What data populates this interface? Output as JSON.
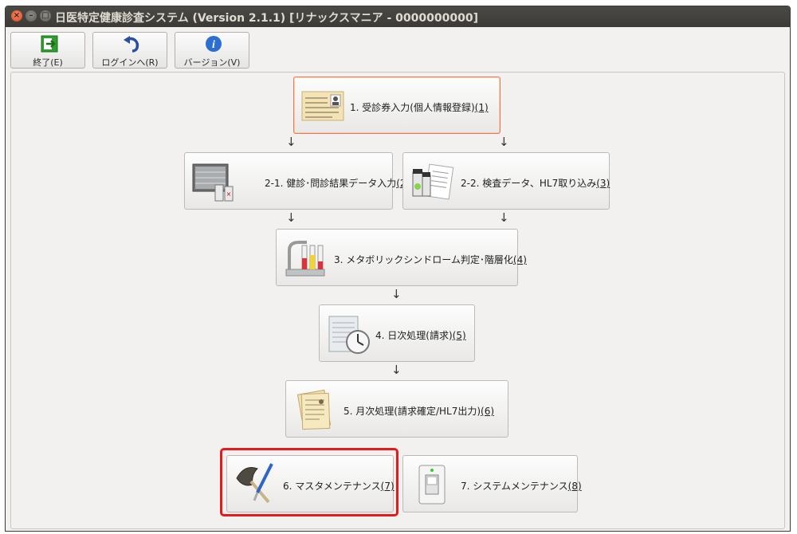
{
  "window": {
    "title": "日医特定健康診査システム (Version 2.1.1) [リナックスマニア - 0000000000]"
  },
  "toolbar": {
    "exit_label": "終了(E)",
    "login_label": "ログインへ(R)",
    "version_label": "バージョン(V)"
  },
  "menu": {
    "b1": {
      "text": "1. 受診券入力(個人情報登録)",
      "key": "(1)"
    },
    "b21": {
      "text": "2-1. 健診･問診結果データ入力",
      "key": "(2)"
    },
    "b22": {
      "text": "2-2. 検査データ、HL7取り込み",
      "key": "(3)"
    },
    "b3": {
      "text": "3. メタボリックシンドローム判定･階層化",
      "key": "(4)"
    },
    "b4": {
      "text": "4. 日次処理(請求)",
      "key": "(5)"
    },
    "b5": {
      "text": "5. 月次処理(請求確定/HL7出力)",
      "key": "(6)"
    },
    "b6": {
      "text": "6. マスタメンテナンス",
      "key": "(7)"
    },
    "b7": {
      "text": "7. システムメンテナンス",
      "key": "(8)"
    }
  },
  "arrows": {
    "glyph": "↓"
  },
  "colors": {
    "focus_border": "#f07746",
    "highlight_border": "#e8191a",
    "titlebar": "#3c3b37"
  }
}
